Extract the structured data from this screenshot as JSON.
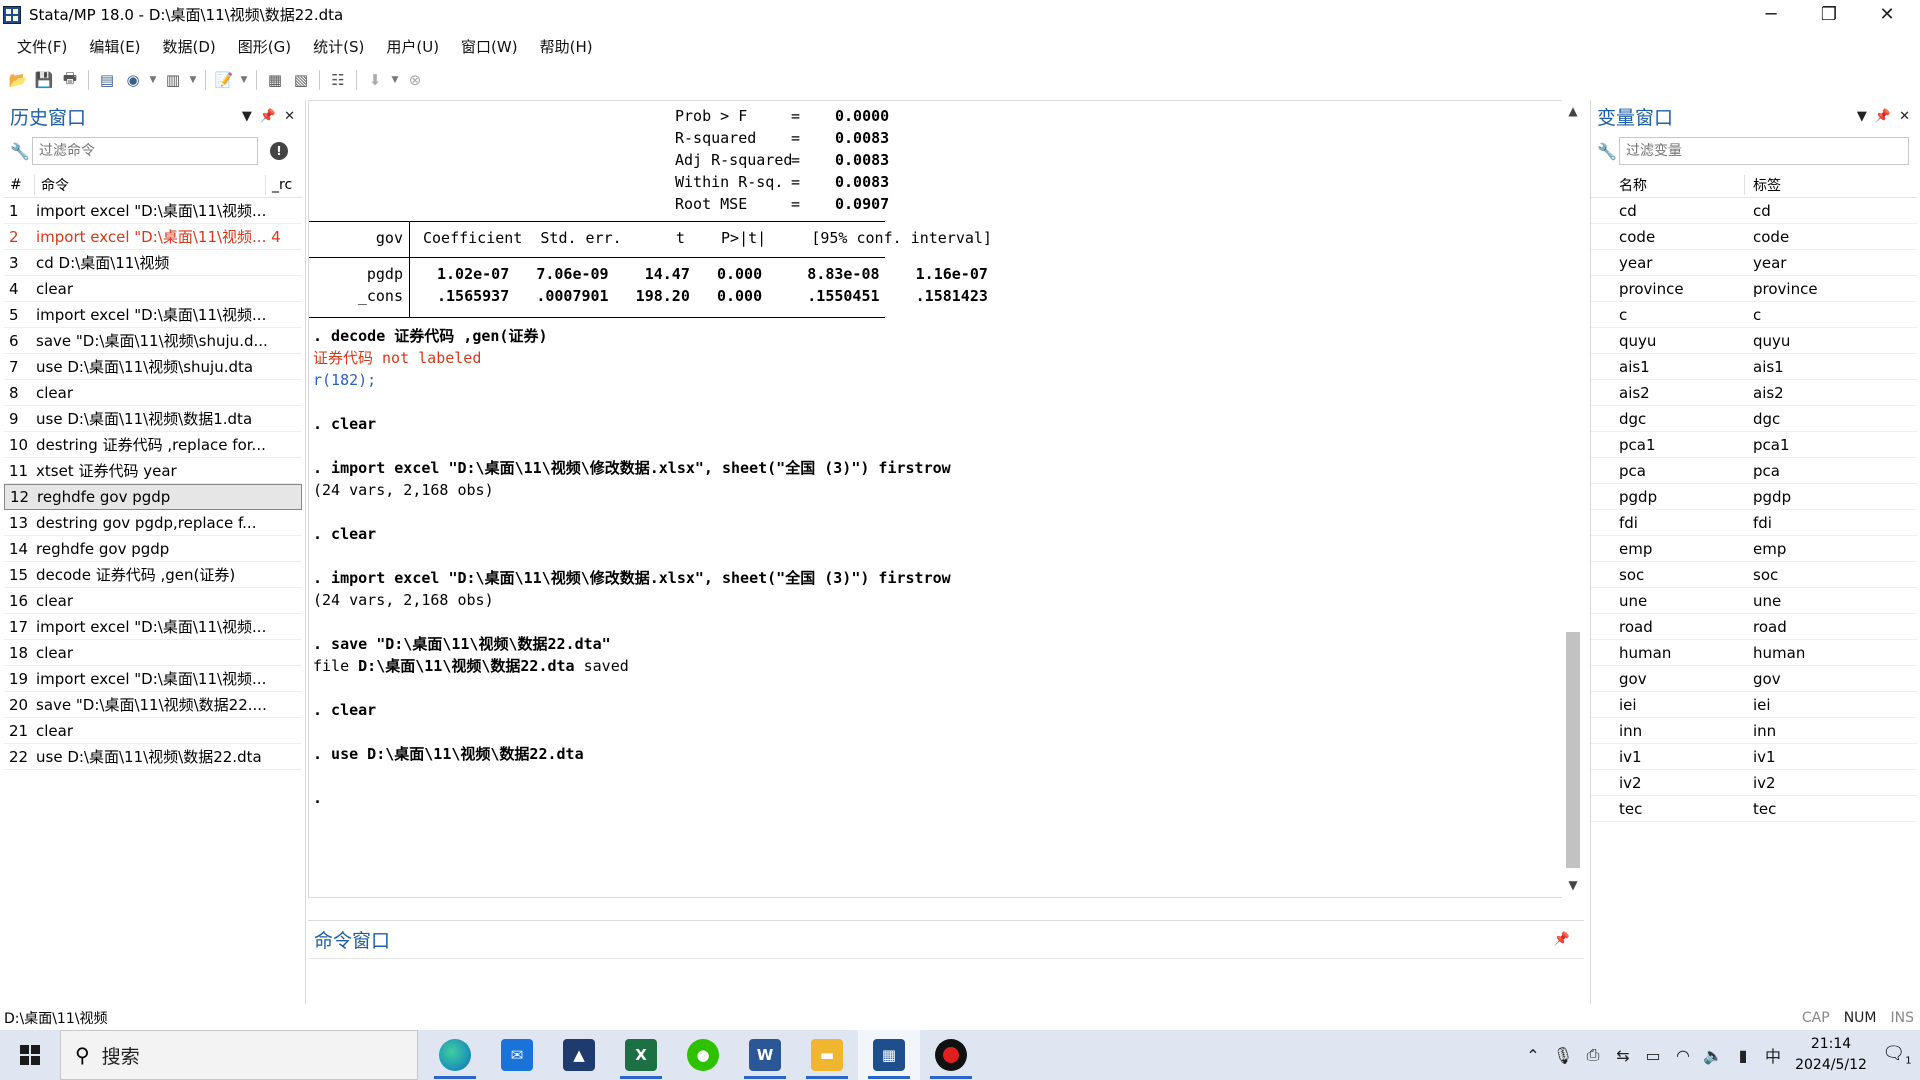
{
  "window": {
    "title": "Stata/MP 18.0 - D:\\桌面\\11\\视频\\数据22.dta",
    "minimize": "─",
    "maximize": "❐",
    "close": "✕"
  },
  "menu": [
    "文件(F)",
    "编辑(E)",
    "数据(D)",
    "图形(G)",
    "统计(S)",
    "用户(U)",
    "窗口(W)",
    "帮助(H)"
  ],
  "history": {
    "title": "历史窗口",
    "filter_placeholder": "过滤命令",
    "col_num": "#",
    "col_cmd": "命令",
    "col_rc": "_rc",
    "rows": [
      {
        "n": "1",
        "cmd": "import excel \"D:\\桌面\\11\\视频..."
      },
      {
        "n": "2",
        "cmd": "import excel \"D:\\桌面\\11\\视频... 4"
      },
      {
        "n": "3",
        "cmd": "cd D:\\桌面\\11\\视频"
      },
      {
        "n": "4",
        "cmd": "clear"
      },
      {
        "n": "5",
        "cmd": "import excel \"D:\\桌面\\11\\视频..."
      },
      {
        "n": "6",
        "cmd": "save \"D:\\桌面\\11\\视频\\shuju.d..."
      },
      {
        "n": "7",
        "cmd": "use D:\\桌面\\11\\视频\\shuju.dta"
      },
      {
        "n": "8",
        "cmd": "clear"
      },
      {
        "n": "9",
        "cmd": "use D:\\桌面\\11\\视频\\数据1.dta"
      },
      {
        "n": "10",
        "cmd": "destring 证券代码 ,replace for..."
      },
      {
        "n": "11",
        "cmd": "xtset 证券代码 year"
      },
      {
        "n": "12",
        "cmd": "reghdfe gov pgdp"
      },
      {
        "n": "13",
        "cmd": "destring  gov pgdp,replace f..."
      },
      {
        "n": "14",
        "cmd": "reghdfe gov pgdp"
      },
      {
        "n": "15",
        "cmd": "decode 证券代码 ,gen(证券)"
      },
      {
        "n": "16",
        "cmd": "clear"
      },
      {
        "n": "17",
        "cmd": "import excel \"D:\\桌面\\11\\视频..."
      },
      {
        "n": "18",
        "cmd": "clear"
      },
      {
        "n": "19",
        "cmd": "import excel \"D:\\桌面\\11\\视频..."
      },
      {
        "n": "20",
        "cmd": "save \"D:\\桌面\\11\\视频\\数据22...."
      },
      {
        "n": "21",
        "cmd": "clear"
      },
      {
        "n": "22",
        "cmd": "use D:\\桌面\\11\\视频\\数据22.dta"
      }
    ]
  },
  "results": {
    "stats": [
      {
        "label": "Prob > F",
        "eq": "=",
        "value": "0.0000"
      },
      {
        "label": "R-squared",
        "eq": "=",
        "value": "0.0083"
      },
      {
        "label": "Adj R-squared",
        "eq": "=",
        "value": "0.0083"
      },
      {
        "label": "Within R-sq.",
        "eq": "=",
        "value": "0.0083"
      },
      {
        "label": "Root MSE",
        "eq": "=",
        "value": "0.0907"
      }
    ],
    "table_header_var": "gov",
    "table_header_cols": "Coefficient  Std. err.      t    P>|t|     [95% conf. interval]",
    "table_rows": [
      {
        "var": "pgdp",
        "vals": "1.02e-07   7.06e-09    14.47   0.000     8.83e-08    1.16e-07"
      },
      {
        "var": "_cons",
        "vals": ".1565937   .0007901   198.20   0.000     .1550451    .1581423"
      }
    ],
    "log": [
      {
        "text": ". decode 证券代码 ,gen(证券)",
        "style": "bold"
      },
      {
        "text": "证券代码 not labeled",
        "style": "red"
      },
      {
        "text": "r(182);",
        "style": "blue"
      },
      {
        "text": "",
        "style": ""
      },
      {
        "text": ". clear",
        "style": "bold"
      },
      {
        "text": "",
        "style": ""
      },
      {
        "text": ". import excel \"D:\\桌面\\11\\视频\\修改数据.xlsx\", sheet(\"全国 (3)\") firstrow",
        "style": "bold"
      },
      {
        "text": "(24 vars, 2,168 obs)",
        "style": ""
      },
      {
        "text": "",
        "style": ""
      },
      {
        "text": ". clear",
        "style": "bold"
      },
      {
        "text": "",
        "style": ""
      },
      {
        "text": ". import excel \"D:\\桌面\\11\\视频\\修改数据.xlsx\", sheet(\"全国 (3)\") firstrow",
        "style": "bold"
      },
      {
        "text": "(24 vars, 2,168 obs)",
        "style": ""
      },
      {
        "text": "",
        "style": ""
      },
      {
        "text": ". save \"D:\\桌面\\11\\视频\\数据22.dta\"",
        "style": "bold"
      },
      {
        "text": "file D:\\桌面\\11\\视频\\数据22.dta saved",
        "style": "saved"
      },
      {
        "text": "",
        "style": ""
      },
      {
        "text": ". clear",
        "style": "bold"
      },
      {
        "text": "",
        "style": ""
      },
      {
        "text": ". use D:\\桌面\\11\\视频\\数据22.dta",
        "style": "bold"
      },
      {
        "text": "",
        "style": ""
      },
      {
        "text": ".",
        "style": "bold"
      }
    ],
    "saved_file": "D:\\桌面\\11\\视频\\数据22.dta",
    "saved_prefix": "file ",
    "saved_suffix": " saved"
  },
  "command": {
    "title": "命令窗口",
    "value": ""
  },
  "variables": {
    "title": "变量窗口",
    "filter_placeholder": "过滤变量",
    "col_name": "名称",
    "col_label": "标签",
    "rows": [
      {
        "name": "cd",
        "label": "cd"
      },
      {
        "name": "code",
        "label": "code"
      },
      {
        "name": "year",
        "label": "year"
      },
      {
        "name": "province",
        "label": "province"
      },
      {
        "name": "c",
        "label": "c"
      },
      {
        "name": "quyu",
        "label": "quyu"
      },
      {
        "name": "ais1",
        "label": "ais1"
      },
      {
        "name": "ais2",
        "label": "ais2"
      },
      {
        "name": "dgc",
        "label": "dgc"
      },
      {
        "name": "pca1",
        "label": "pca1"
      },
      {
        "name": "pca",
        "label": "pca"
      },
      {
        "name": "pgdp",
        "label": "pgdp"
      },
      {
        "name": "fdi",
        "label": "fdi"
      },
      {
        "name": "emp",
        "label": "emp"
      },
      {
        "name": "soc",
        "label": "soc"
      },
      {
        "name": "une",
        "label": "une"
      },
      {
        "name": "road",
        "label": "road"
      },
      {
        "name": "human",
        "label": "human"
      },
      {
        "name": "gov",
        "label": "gov"
      },
      {
        "name": "iei",
        "label": "iei"
      },
      {
        "name": "inn",
        "label": "inn"
      },
      {
        "name": "iv1",
        "label": "iv1"
      },
      {
        "name": "iv2",
        "label": "iv2"
      },
      {
        "name": "tec",
        "label": "tec"
      }
    ]
  },
  "status": {
    "path": "D:\\桌面\\11\\视频",
    "cap": "CAP",
    "num": "NUM",
    "ins": "INS"
  },
  "taskbar": {
    "search_label": "搜索",
    "ime": "中",
    "time": "21:14",
    "date": "2024/5/12",
    "notif_count": "1"
  },
  "colors": {
    "panel_title": "#1d5fa8",
    "error": "#d43a1a",
    "link": "#2b64b8",
    "taskbar_bg": "#dfe6f2"
  }
}
